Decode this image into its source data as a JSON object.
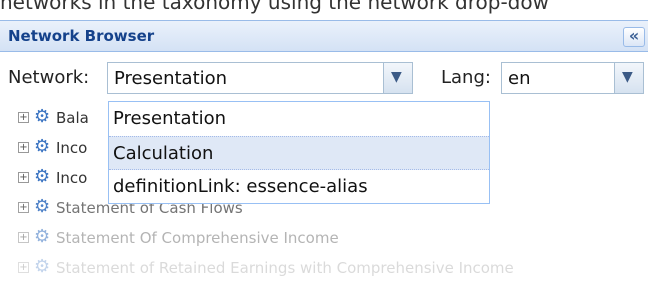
{
  "caption": "networks in the taxonomy using the network drop-dow",
  "panel": {
    "title": "Network Browser",
    "collapse_icon": "«"
  },
  "toolbar": {
    "network_label": "Network:",
    "network_value": "Presentation",
    "lang_label": "Lang:",
    "lang_value": "en",
    "dropdown_arrow": "▼"
  },
  "tree": {
    "expander": "+",
    "gear_icon": "⚙",
    "items": [
      {
        "label": "Bala"
      },
      {
        "label": "Inco"
      },
      {
        "label": "Inco"
      },
      {
        "label": "Statement of Cash Flows"
      },
      {
        "label": "Statement Of Comprehensive Income"
      },
      {
        "label": "Statement of Retained Earnings with Comprehensive Income"
      }
    ]
  },
  "dropdown": {
    "options": [
      {
        "label": "Presentation"
      },
      {
        "label": "Calculation"
      },
      {
        "label": "definitionLink: essence-alias"
      }
    ],
    "highlighted": "Calculation"
  }
}
